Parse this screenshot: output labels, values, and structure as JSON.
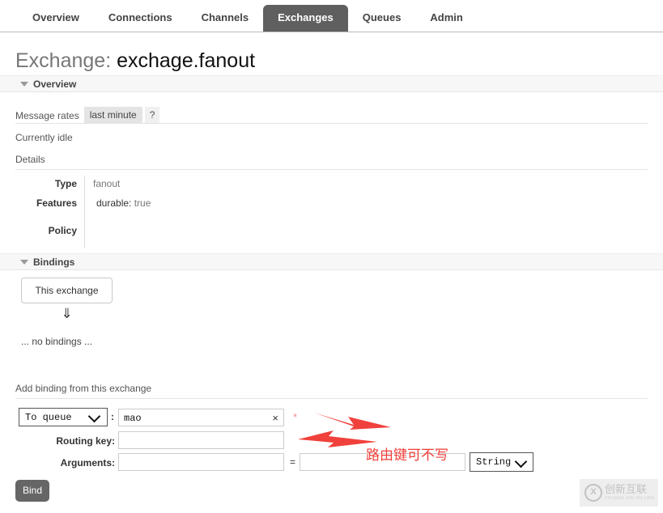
{
  "nav": {
    "tabs": [
      {
        "label": "Overview",
        "active": false
      },
      {
        "label": "Connections",
        "active": false
      },
      {
        "label": "Channels",
        "active": false
      },
      {
        "label": "Exchanges",
        "active": true
      },
      {
        "label": "Queues",
        "active": false
      },
      {
        "label": "Admin",
        "active": false
      }
    ]
  },
  "page": {
    "title_lead": "Exchange:",
    "title_name": "exchage.fanout"
  },
  "overview": {
    "section_label": "Overview",
    "message_rates_label": "Message rates",
    "rate_range": "last minute",
    "help": "?",
    "idle_text": "Currently idle",
    "details_label": "Details",
    "details_rows": [
      {
        "label": "Type",
        "value": "fanout"
      },
      {
        "label": "Features",
        "feature_key": "durable:",
        "feature_value": "true"
      },
      {
        "label": "Policy",
        "value": ""
      }
    ]
  },
  "bindings": {
    "section_label": "Bindings",
    "this_exchange": "This exchange",
    "down_arrow": "⇓",
    "no_bindings": "... no bindings ..."
  },
  "add_binding": {
    "heading": "Add binding from this exchange",
    "destination_select": "To queue",
    "colon": ":",
    "destination_value": "mao",
    "clear_icon": "×",
    "required_marker": "*",
    "routing_key_label": "Routing key:",
    "routing_key_value": "",
    "arguments_label": "Arguments:",
    "argument_key_value": "",
    "equals": "=",
    "argument_value_value": "",
    "type_select": "String",
    "bind_button": "Bind"
  },
  "annotations": {
    "note_text": "路由键可不写"
  },
  "watermark": {
    "mark": "X",
    "cn": "创新互联",
    "en": "CHUANG XIN HU LIAN"
  },
  "colors": {
    "active_tab_bg": "#5f5f5f",
    "annotation_red": "#f0413c",
    "button_bg": "#666666"
  }
}
